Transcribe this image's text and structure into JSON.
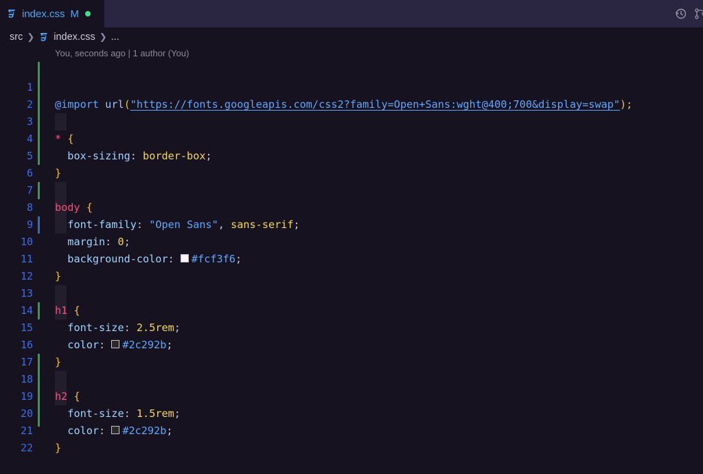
{
  "tab": {
    "title": "index.css",
    "status": "M",
    "icons": {
      "file": "css-file-icon",
      "history": "history-icon",
      "source_control": "source-control-icon"
    }
  },
  "breadcrumb": {
    "folder": "src",
    "file": "index.css",
    "more": "..."
  },
  "blame": "You, seconds ago | 1 author (You)",
  "colors": {
    "accent": "#4aa8f5",
    "modified_dot": "#3fe08a",
    "line_number": "#3a6df0",
    "gutter_added": "#2ea043",
    "gutter_modified": "#2f6fb5"
  },
  "code": {
    "l1": {
      "n": "1",
      "at": "@import",
      "fn": "url",
      "open": "(",
      "url": "\"https://fonts.googleapis.com/css2?family=Open+Sans:wght@400;700&display=swap\"",
      "close": ")",
      "semi": ";"
    },
    "l2": {
      "n": "2"
    },
    "l3": {
      "n": "3",
      "sel": "*",
      "brace": "{"
    },
    "l4": {
      "n": "4",
      "prop": "box-sizing",
      "colon": ":",
      "val": "border-box",
      "semi": ";"
    },
    "l5": {
      "n": "5",
      "brace": "}"
    },
    "l6": {
      "n": "6"
    },
    "l7": {
      "n": "7",
      "sel": "body",
      "brace": "{"
    },
    "l8": {
      "n": "8",
      "prop": "font-family",
      "colon": ":",
      "str": "\"Open Sans\"",
      "comma": ",",
      "val": "sans-serif",
      "semi": ";"
    },
    "l9": {
      "n": "9",
      "prop": "margin",
      "colon": ":",
      "val": "0",
      "semi": ";"
    },
    "l10": {
      "n": "10",
      "prop": "background-color",
      "colon": ":",
      "swatch": "#fcf3f6",
      "val": "#fcf3f6",
      "semi": ";"
    },
    "l11": {
      "n": "11",
      "brace": "}"
    },
    "l12": {
      "n": "12"
    },
    "l13": {
      "n": "13",
      "sel": "h1",
      "brace": "{"
    },
    "l14": {
      "n": "14",
      "prop": "font-size",
      "colon": ":",
      "val": "2.5rem",
      "semi": ";"
    },
    "l15": {
      "n": "15",
      "prop": "color",
      "colon": ":",
      "swatch": "#2c292b",
      "val": "#2c292b",
      "semi": ";"
    },
    "l16": {
      "n": "16",
      "brace": "}"
    },
    "l17": {
      "n": "17"
    },
    "l18": {
      "n": "18",
      "sel": "h2",
      "brace": "{"
    },
    "l19": {
      "n": "19",
      "prop": "font-size",
      "colon": ":",
      "val": "1.5rem",
      "semi": ";"
    },
    "l20": {
      "n": "20",
      "prop": "color",
      "colon": ":",
      "swatch": "#2c292b",
      "val": "#2c292b",
      "semi": ";"
    },
    "l21": {
      "n": "21",
      "brace": "}"
    },
    "l22": {
      "n": "22"
    }
  }
}
